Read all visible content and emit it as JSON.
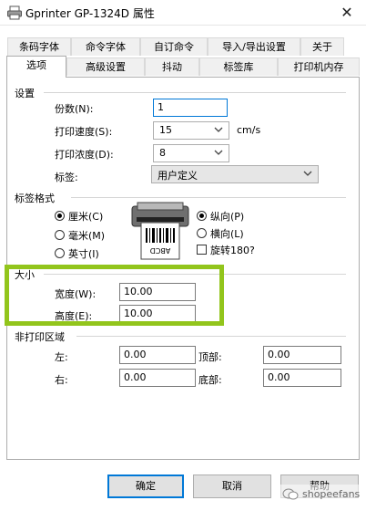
{
  "window": {
    "title": "Gprinter GP-1324D 属性",
    "close_glyph": "✕"
  },
  "tabs_row1": [
    "条码字体",
    "命令字体",
    "自订命令",
    "导入/导出设置",
    "关于"
  ],
  "tabs_row2": [
    "选项",
    "高级设置",
    "抖动",
    "标签库",
    "打印机内存"
  ],
  "settings": {
    "title": "设置",
    "copies_label": "份数(N):",
    "copies_value": "1",
    "speed_label": "打印速度(S):",
    "speed_value": "15",
    "speed_unit": "cm/s",
    "density_label": "打印浓度(D):",
    "density_value": "8",
    "label_label": "标签:",
    "label_value": "用户定义"
  },
  "format": {
    "title": "标签格式",
    "unit_cm": "厘米(C)",
    "unit_mm": "毫米(M)",
    "unit_inch": "英寸(I)",
    "portrait": "纵向(P)",
    "landscape": "横向(L)",
    "rotate": "旋转180?",
    "preview_text": "ABCD",
    "selected_unit": "cm",
    "selected_orientation": "portrait",
    "rotate_checked": false
  },
  "size": {
    "title": "大小",
    "width_label": "宽度(W):",
    "width_value": "10.00",
    "height_label": "高度(E):",
    "height_value": "10.00"
  },
  "nonprint": {
    "title": "非打印区域",
    "left_label": "左:",
    "left_value": "0.00",
    "top_label": "顶部:",
    "top_value": "0.00",
    "right_label": "右:",
    "right_value": "0.00",
    "bottom_label": "底部:",
    "bottom_value": "0.00"
  },
  "buttons": {
    "ok": "确定",
    "cancel": "取消",
    "help": "帮助"
  },
  "watermark": "shopeefans",
  "colors": {
    "highlight": "#92c51c",
    "focus": "#0078d7"
  }
}
